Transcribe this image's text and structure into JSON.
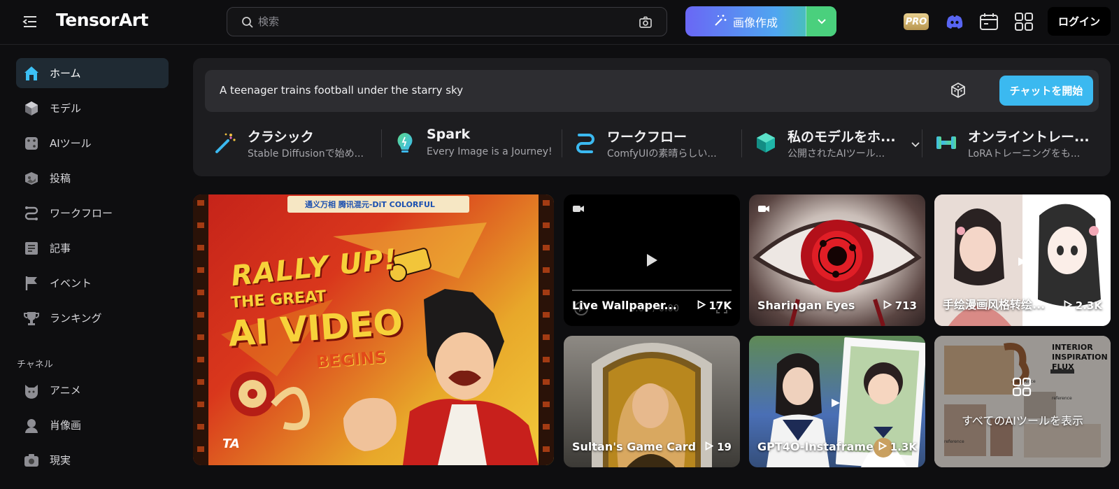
{
  "header": {
    "logo": "TensorArt",
    "search_placeholder": "検索",
    "create_label": "画像作成",
    "pro_badge": "PRO",
    "login_label": "ログイン"
  },
  "sidebar": {
    "items": [
      {
        "label": "ホーム",
        "icon": "home-icon"
      },
      {
        "label": "モデル",
        "icon": "cube-icon"
      },
      {
        "label": "AIツール",
        "icon": "dice-icon"
      },
      {
        "label": "投稿",
        "icon": "post-icon"
      },
      {
        "label": "ワークフロー",
        "icon": "workflow-icon"
      },
      {
        "label": "記事",
        "icon": "article-icon"
      },
      {
        "label": "イベント",
        "icon": "flag-icon"
      },
      {
        "label": "ランキング",
        "icon": "trophy-icon"
      }
    ],
    "channel_label": "チャネル",
    "channels": [
      {
        "label": "アニメ",
        "icon": "cat-icon"
      },
      {
        "label": "肖像画",
        "icon": "person-icon"
      },
      {
        "label": "現実",
        "icon": "camera-icon"
      }
    ]
  },
  "panel": {
    "prompt_text": "A teenager trains football under the starry sky",
    "chat_button": "チャットを開始",
    "tools": [
      {
        "title": "クラシック",
        "subtitle": "Stable Diffusionで始め...",
        "icon": "magic-wand-icon"
      },
      {
        "title": "Spark",
        "subtitle": "Every Image is a Journey!",
        "icon": "bulb-icon"
      },
      {
        "title": "ワークフロー",
        "subtitle": "ComfyUIの素晴らしい...",
        "icon": "workflow-icon"
      },
      {
        "title": "私のモデルをホ...",
        "subtitle": "公開されたAIツール...",
        "icon": "cube-icon"
      },
      {
        "title": "オンライントレー...",
        "subtitle": "LoRAトレーニングをも...",
        "icon": "dumbbell-icon"
      }
    ]
  },
  "banner": {
    "line1": "RALLY UP!",
    "line2": "THE GREAT",
    "line3": "AI VIDEO",
    "line4": "BEGINS",
    "sponsors": "通义万相  腾讯混元-DiT  COLORFUL",
    "corner_logo": "TA"
  },
  "cards": [
    {
      "title": "Live Wallpaper...",
      "count": "17K",
      "time": "0:00 / 0:00"
    },
    {
      "title": "Sharingan Eyes",
      "count": "713"
    },
    {
      "title": "手绘漫画风格转绘...",
      "count": "2.3K"
    },
    {
      "title": "Sultan's Game Card",
      "count": "19"
    },
    {
      "title": "GPT4O-Instaframe",
      "count": "1.3K"
    },
    {
      "title": "すべてのAIツールを表示",
      "overlay_heading": "INTERIOR INSPIRATION FLUX",
      "ref1": "reference",
      "ref2": "reference",
      "ref3": "reference"
    }
  ]
}
